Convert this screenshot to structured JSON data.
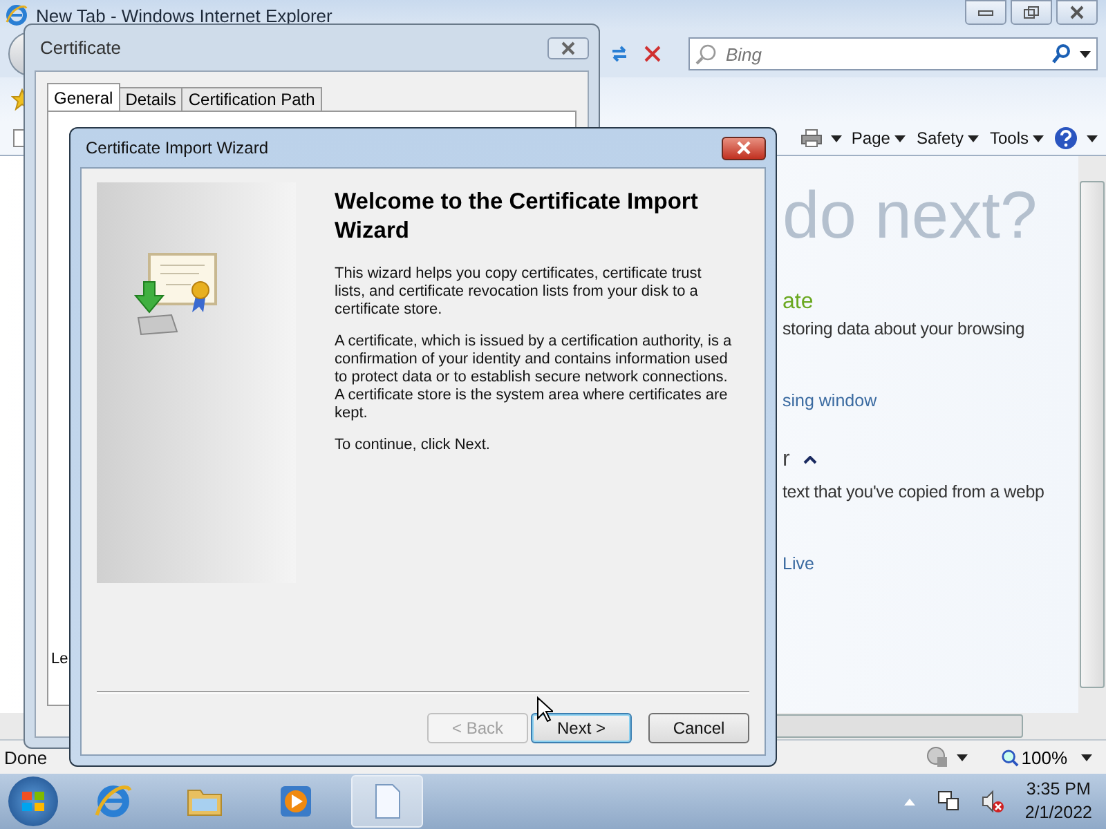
{
  "browser": {
    "title": "New Tab - Windows Internet Explorer",
    "search": {
      "placeholder": "Bing"
    },
    "commands": [
      "Page",
      "Safety",
      "Tools"
    ],
    "content": [
      {
        "kind": "headline",
        "text": "do next?"
      },
      {
        "kind": "section",
        "text": "ate"
      },
      {
        "kind": "body",
        "text": "storing data about your browsing"
      },
      {
        "kind": "link",
        "text": "sing window"
      },
      {
        "kind": "subsection",
        "text": "r"
      },
      {
        "kind": "body",
        "text": "text that you've copied from a webp"
      },
      {
        "kind": "link",
        "text": "Live"
      }
    ],
    "status": "Done",
    "zoom": "100%"
  },
  "certificate_dialog": {
    "title": "Certificate",
    "tabs": [
      {
        "label": "General",
        "selected": true
      },
      {
        "label": "Details",
        "selected": false
      },
      {
        "label": "Certification Path",
        "selected": false
      }
    ],
    "partial_text": "Le"
  },
  "wizard": {
    "title": "Certificate Import Wizard",
    "heading": "Welcome to the Certificate Import Wizard",
    "paragraphs": [
      "This wizard helps you copy certificates, certificate trust lists, and certificate revocation lists from your disk to a certificate store.",
      "A certificate, which is issued by a certification authority, is a confirmation of your identity and contains information used to protect data or to establish secure network connections. A certificate store is the system area where certificates are kept.",
      "To continue, click Next."
    ],
    "buttons": [
      {
        "label": "< Back",
        "disabled": true,
        "default": false
      },
      {
        "label": "Next >",
        "disabled": false,
        "default": true
      },
      {
        "label": "Cancel",
        "disabled": false,
        "default": false
      }
    ]
  },
  "taskbar": {
    "items": [
      {
        "kind": "browser",
        "selected": false
      },
      {
        "kind": "folder",
        "selected": false
      },
      {
        "kind": "media",
        "selected": false
      },
      {
        "kind": "document",
        "selected": true
      }
    ],
    "time": "3:35 PM",
    "date": "2/1/2022"
  }
}
